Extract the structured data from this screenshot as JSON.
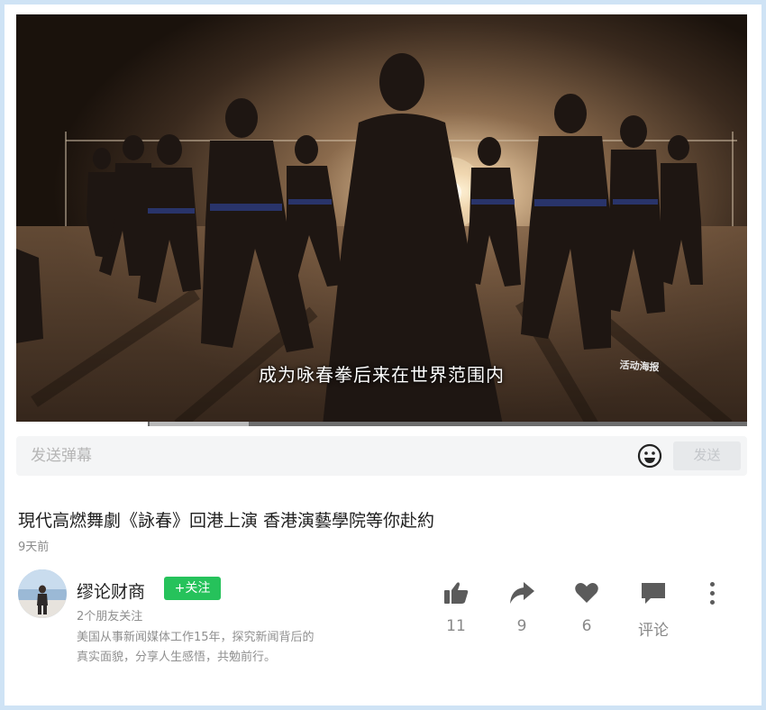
{
  "video": {
    "subtitle": "成为咏春拳后来在世界范围内",
    "watermark": "活动海报",
    "progress": 0.18
  },
  "danmaku": {
    "placeholder": "发送弹幕",
    "send_label": "发送",
    "emoji_icon": "smiley-icon"
  },
  "post": {
    "title": "現代高燃舞劇《詠春》回港上演 香港演藝學院等你赴約",
    "time": "9天前"
  },
  "author": {
    "name": "缪论财商",
    "follow_label": "+关注",
    "friends": "2个朋友关注",
    "bio": "美国从事新闻媒体工作15年，探究新闻背后的真实面貌，分享人生感悟，共勉前行。"
  },
  "actions": {
    "like": {
      "icon": "thumbs-up-icon",
      "count": "11"
    },
    "share": {
      "icon": "share-arrow-icon",
      "count": "9"
    },
    "favorite": {
      "icon": "heart-icon",
      "count": "6"
    },
    "comment": {
      "icon": "comment-icon",
      "label": "评论"
    },
    "more_icon": "more-vertical-icon"
  },
  "colors": {
    "accent_green": "#26c25b",
    "icon_gray": "#5b5b5b"
  }
}
